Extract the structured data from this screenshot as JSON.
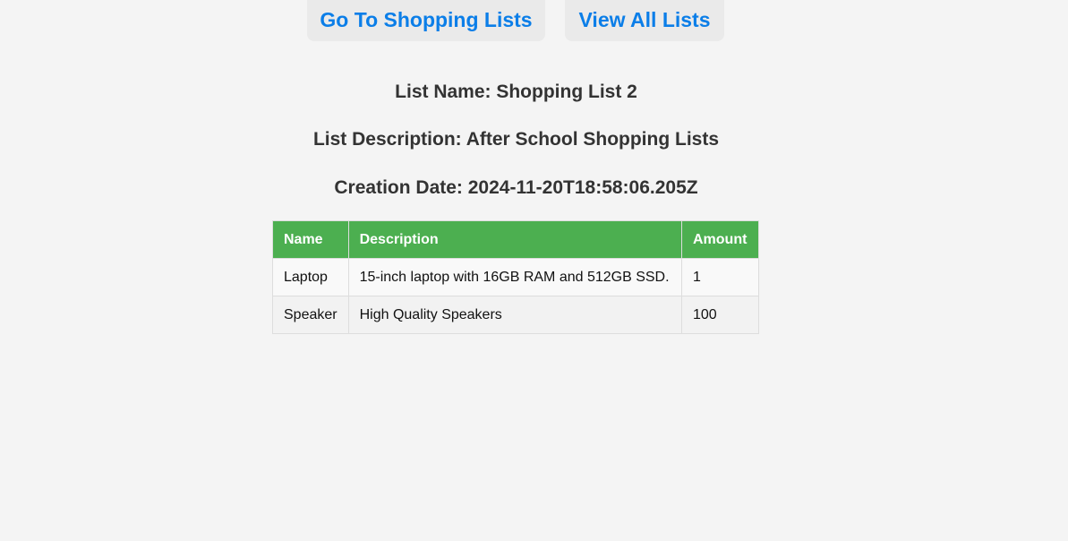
{
  "nav": {
    "shopping_lists_label": "Go To Shopping Lists",
    "view_all_label": "View All Lists"
  },
  "list": {
    "name_text": "List Name: Shopping List 2",
    "description_text": "List Description: After School Shopping Lists",
    "creation_date_text": "Creation Date: 2024-11-20T18:58:06.205Z"
  },
  "table": {
    "headers": [
      "Name",
      "Description",
      "Amount"
    ],
    "rows": [
      {
        "name": "Laptop",
        "description": "15-inch laptop with 16GB RAM and 512GB SSD.",
        "amount": "1"
      },
      {
        "name": "Speaker",
        "description": "High Quality Speakers",
        "amount": "100"
      }
    ]
  },
  "colors": {
    "background": "#f4f4f4",
    "link": "#0b7ee8",
    "header_bg": "#4caf50"
  }
}
